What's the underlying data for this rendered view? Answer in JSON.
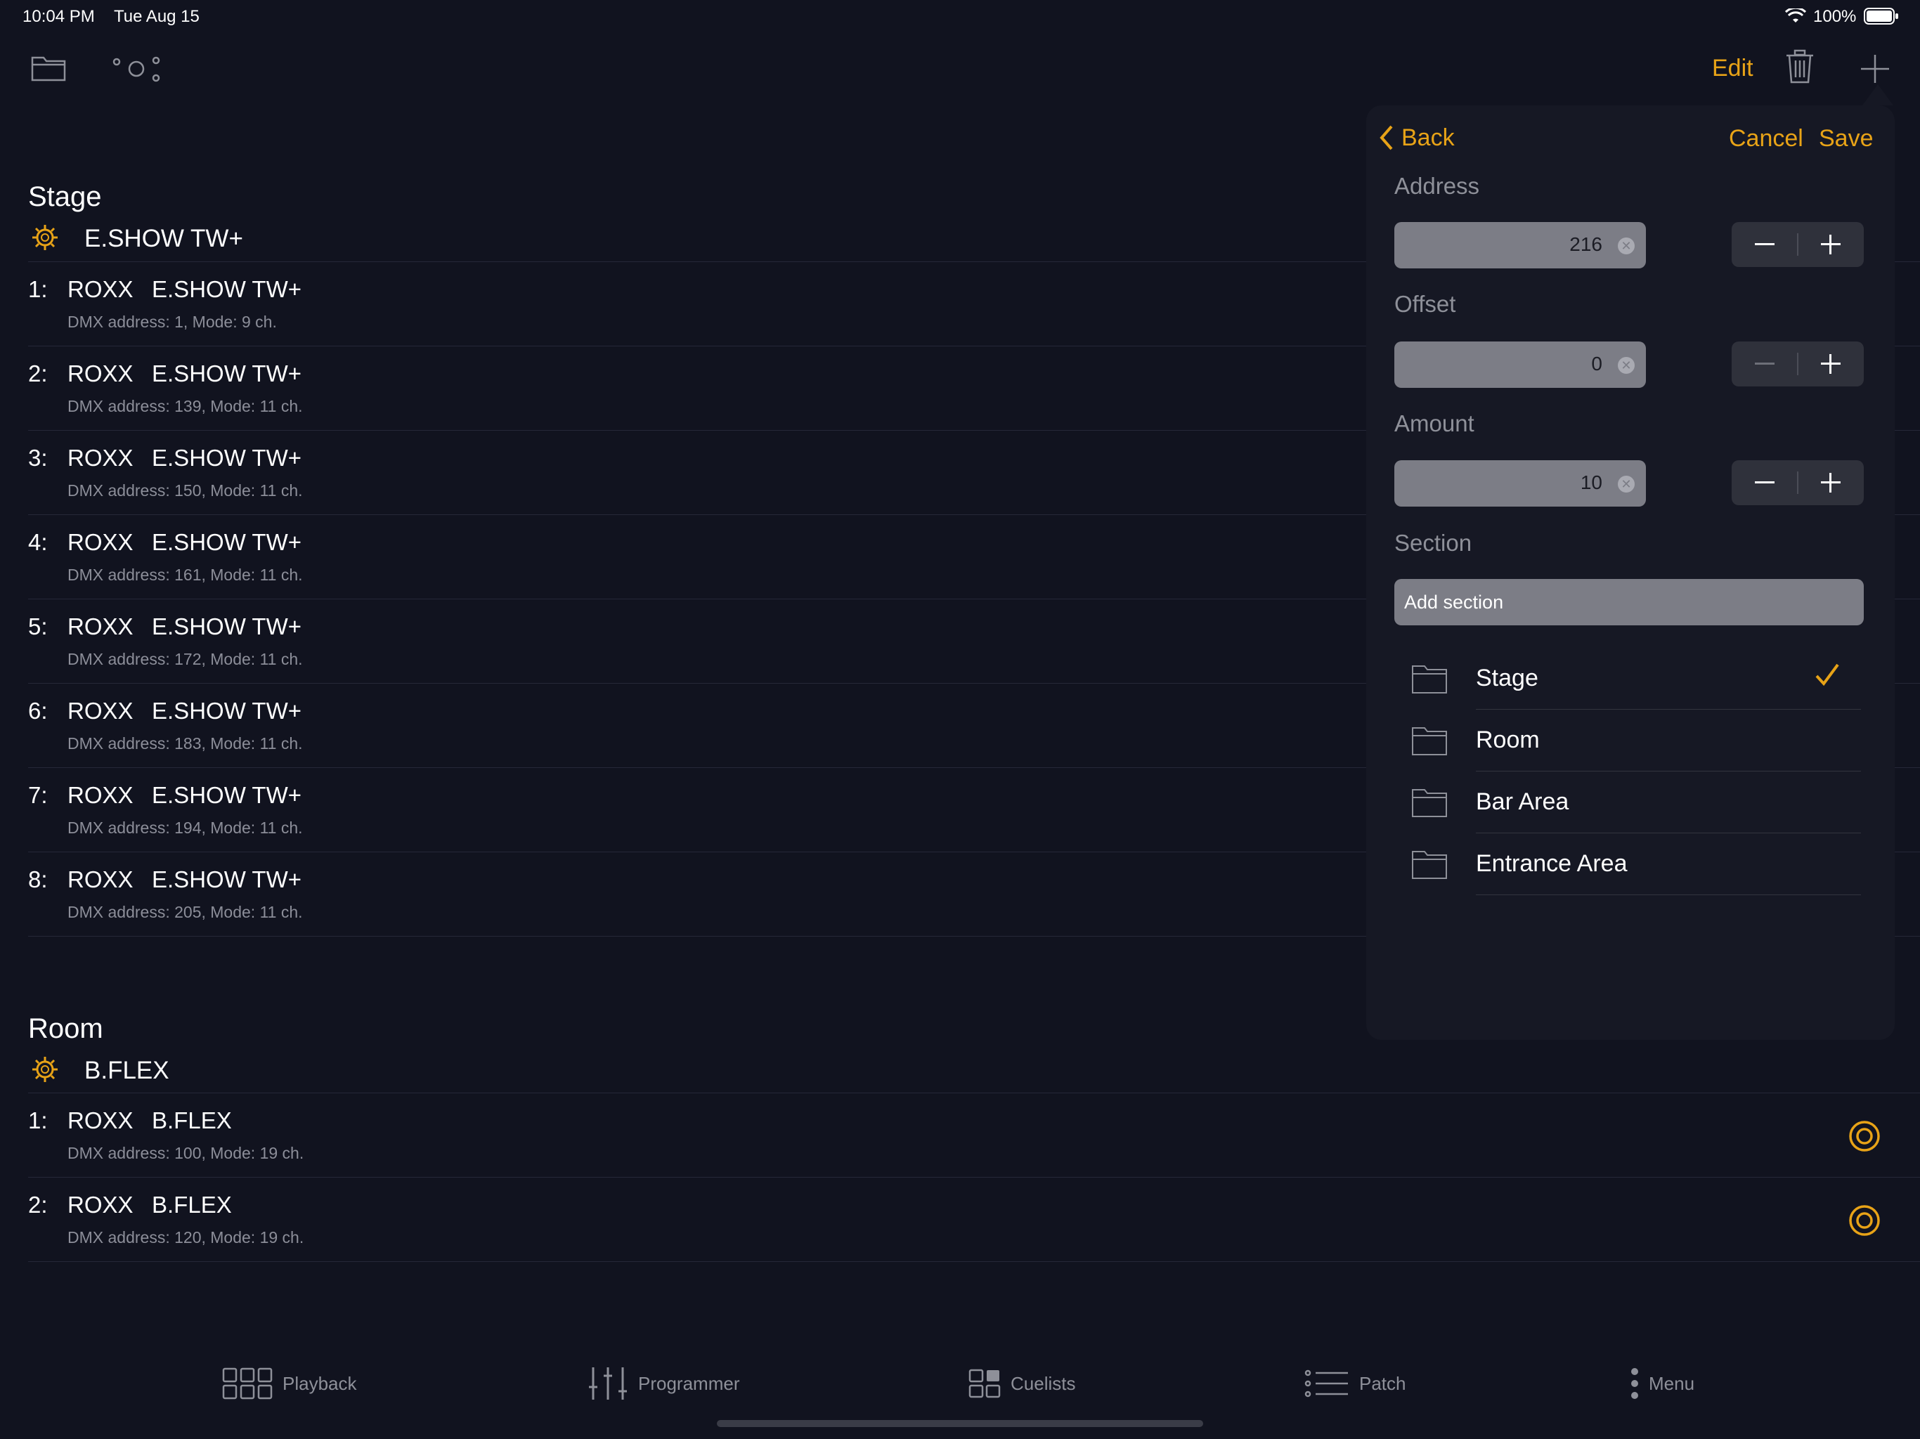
{
  "status_bar": {
    "time": "10:04 PM",
    "date": "Tue Aug 15",
    "battery": "100%"
  },
  "toolbar": {
    "edit_label": "Edit"
  },
  "sections": [
    {
      "title": "Stage",
      "group": "E.SHOW TW+",
      "fixtures": [
        {
          "index": "1:",
          "brand": "ROXX",
          "model": "E.SHOW TW+",
          "info": "DMX address: 1, Mode: 9 ch."
        },
        {
          "index": "2:",
          "brand": "ROXX",
          "model": "E.SHOW TW+",
          "info": "DMX address: 139, Mode: 11 ch."
        },
        {
          "index": "3:",
          "brand": "ROXX",
          "model": "E.SHOW TW+",
          "info": "DMX address: 150, Mode: 11 ch."
        },
        {
          "index": "4:",
          "brand": "ROXX",
          "model": "E.SHOW TW+",
          "info": "DMX address: 161, Mode: 11 ch."
        },
        {
          "index": "5:",
          "brand": "ROXX",
          "model": "E.SHOW TW+",
          "info": "DMX address: 172, Mode: 11 ch."
        },
        {
          "index": "6:",
          "brand": "ROXX",
          "model": "E.SHOW TW+",
          "info": "DMX address: 183, Mode: 11 ch."
        },
        {
          "index": "7:",
          "brand": "ROXX",
          "model": "E.SHOW TW+",
          "info": "DMX address: 194, Mode: 11 ch."
        },
        {
          "index": "8:",
          "brand": "ROXX",
          "model": "E.SHOW TW+",
          "info": "DMX address: 205, Mode: 11 ch."
        }
      ]
    },
    {
      "title": "Room",
      "group": "B.FLEX",
      "fixtures": [
        {
          "index": "1:",
          "brand": "ROXX",
          "model": "B.FLEX",
          "info": "DMX address: 100, Mode: 19 ch."
        },
        {
          "index": "2:",
          "brand": "ROXX",
          "model": "B.FLEX",
          "info": "DMX address: 120, Mode: 19 ch."
        }
      ]
    }
  ],
  "popover": {
    "back_label": "Back",
    "cancel_label": "Cancel",
    "save_label": "Save",
    "address": {
      "label": "Address",
      "value": "216"
    },
    "offset": {
      "label": "Offset",
      "value": "0"
    },
    "amount": {
      "label": "Amount",
      "value": "10"
    },
    "section": {
      "label": "Section",
      "add_placeholder": "Add section",
      "items": [
        {
          "name": "Stage",
          "selected": true
        },
        {
          "name": "Room",
          "selected": false
        },
        {
          "name": "Bar Area",
          "selected": false
        },
        {
          "name": "Entrance Area",
          "selected": false
        }
      ]
    }
  },
  "tabs": [
    {
      "label": "Playback",
      "icon": "grid-icon"
    },
    {
      "label": "Programmer",
      "icon": "sliders-icon"
    },
    {
      "label": "Cuelists",
      "icon": "cuelists-icon"
    },
    {
      "label": "Patch",
      "icon": "list-icon"
    },
    {
      "label": "Menu",
      "icon": "more-icon"
    }
  ],
  "colors": {
    "accent": "#e8a317",
    "background": "#11131f"
  }
}
